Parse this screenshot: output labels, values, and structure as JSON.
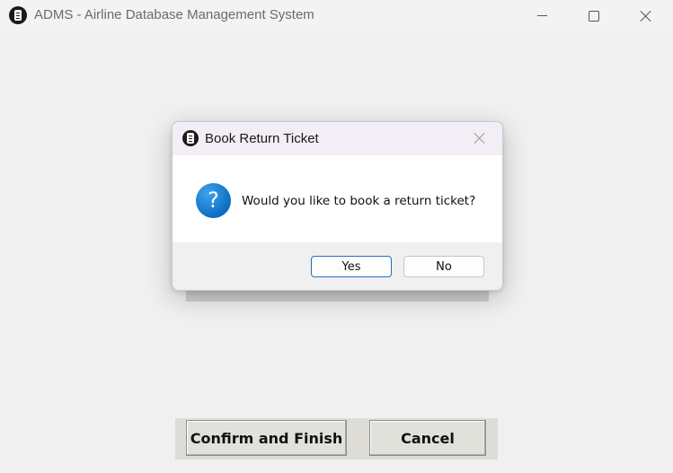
{
  "window": {
    "title": "ADMS - Airline Database Management System",
    "app_icon": "database-icon",
    "controls": [
      "minimize-icon",
      "maximize-icon",
      "close-icon"
    ]
  },
  "actions": {
    "confirm_label": "Confirm and Finish",
    "cancel_label": "Cancel"
  },
  "dialog": {
    "title": "Book Return Ticket",
    "icon": "question-icon",
    "icon_glyph": "?",
    "message": "Would you like to book a return ticket?",
    "yes_label": "Yes",
    "no_label": "No",
    "default_button": "Yes",
    "accent_color": "#1f6fc4"
  }
}
